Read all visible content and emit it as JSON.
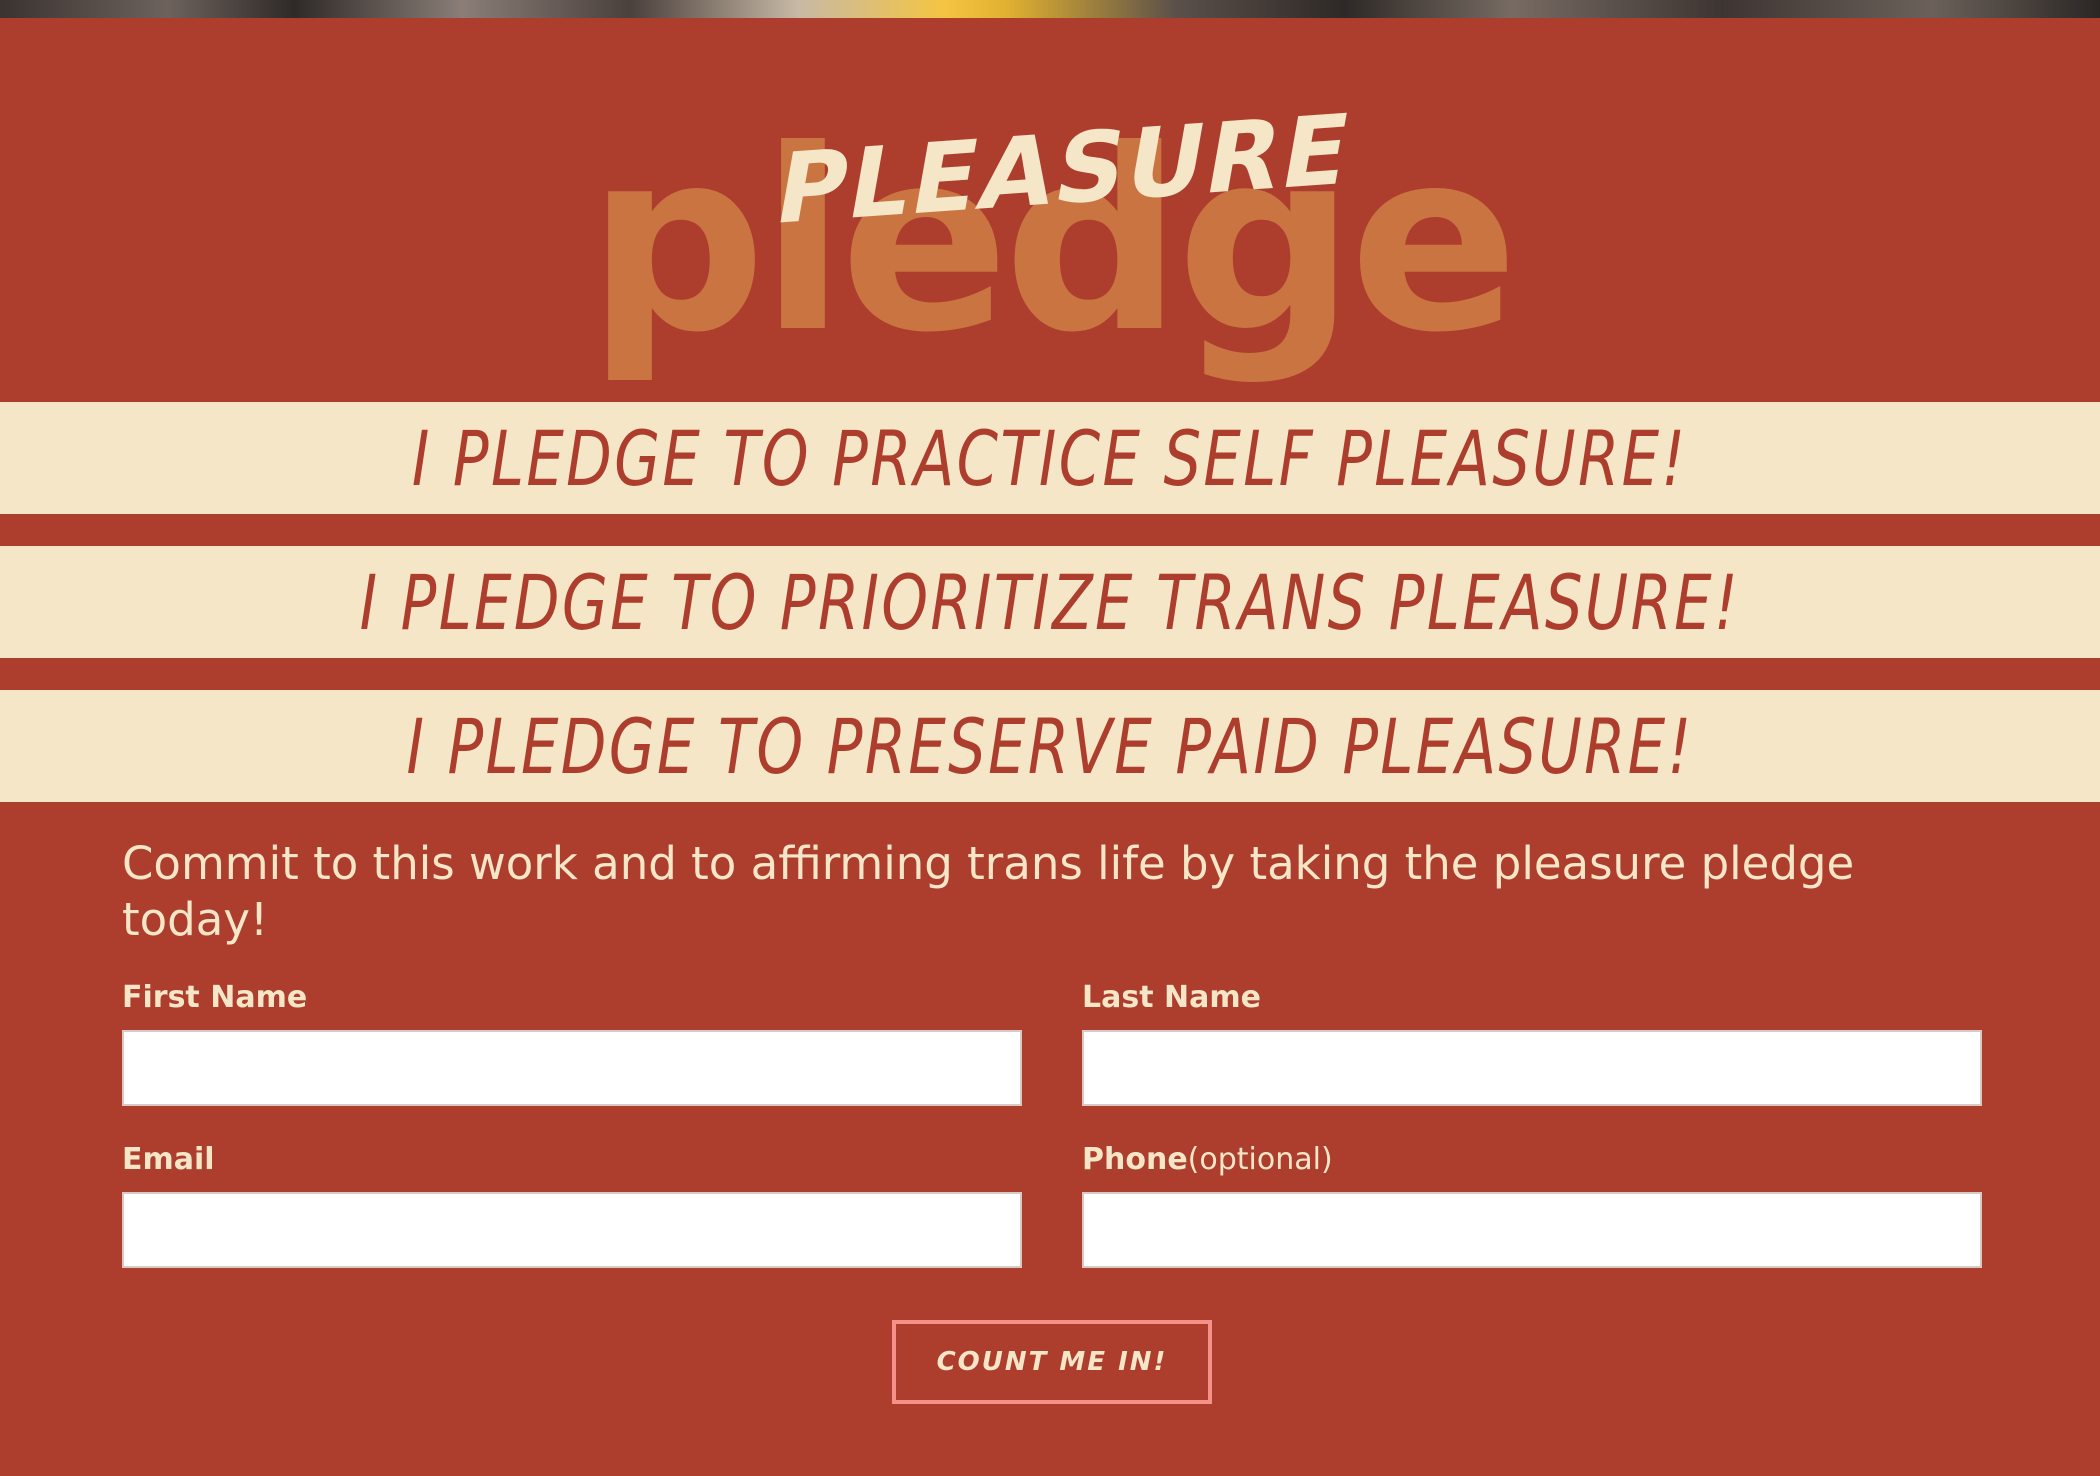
{
  "logo": {
    "script_text": "PLEASURE",
    "block_text": "pledge"
  },
  "pledges": [
    "I pledge to practice self pleasure!",
    "I pledge to prioritize trans pleasure!",
    "I pledge to preserve paid pleasure!"
  ],
  "intro": "Commit to this work and to affirming trans life by taking the pleasure pledge today!",
  "form": {
    "first_name_label": "First Name",
    "last_name_label": "Last Name",
    "email_label": "Email",
    "phone_label": "Phone",
    "phone_optional": "(optional)",
    "first_name_value": "",
    "last_name_value": "",
    "email_value": "",
    "phone_value": "",
    "submit_label": "Count me in!"
  },
  "colors": {
    "background": "#ad3e2e",
    "cream": "#f5e6c8",
    "logo_orange": "#c97441",
    "button_border": "#f4928a"
  }
}
